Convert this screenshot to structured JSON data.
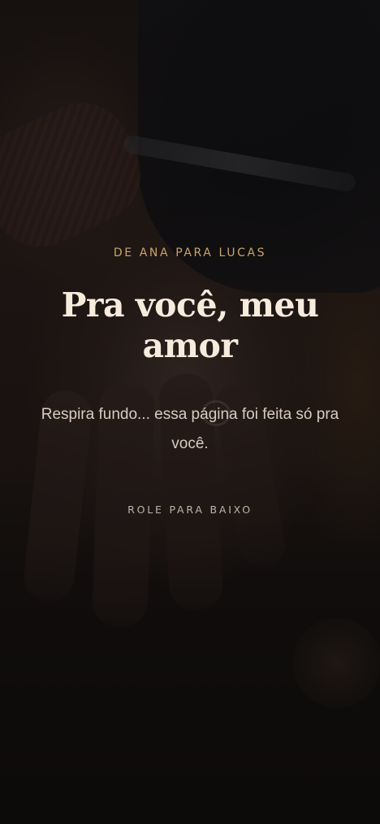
{
  "hero": {
    "eyebrow": "DE ANA PARA LUCAS",
    "title": "Pra você, meu amor",
    "subtitle": "Respira fundo... essa página foi feita só pra você.",
    "scroll_hint": "ROLE PARA BAIXO"
  },
  "colors": {
    "accent": "#c9a36c",
    "title": "#f6ebdd",
    "body_text": "#d8cbbf",
    "background": "#1c1512"
  }
}
